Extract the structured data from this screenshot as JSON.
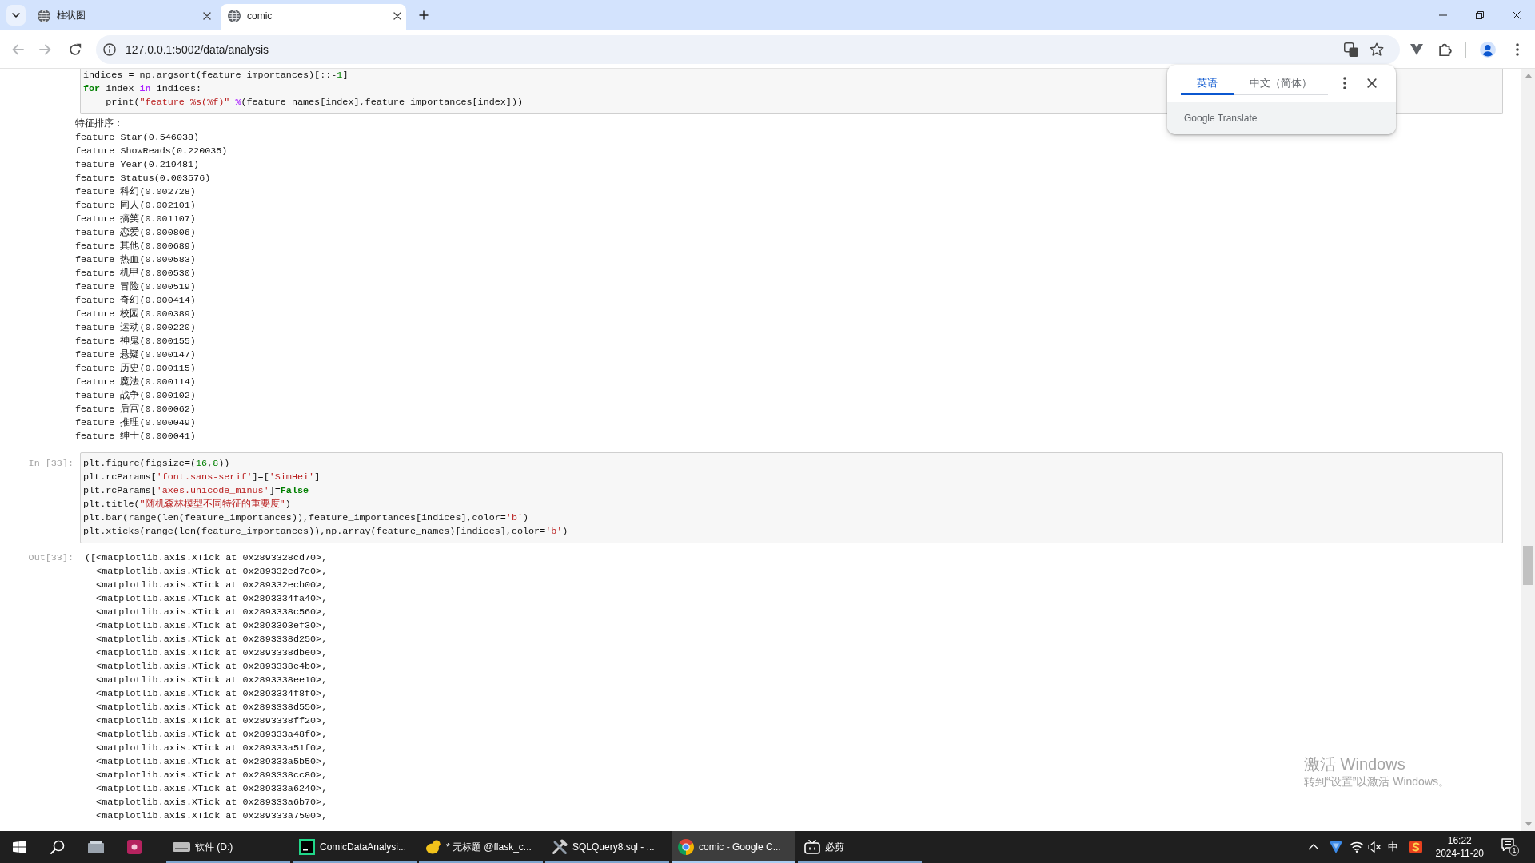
{
  "browser": {
    "tabs": [
      {
        "title": "柱状图",
        "selected": false
      },
      {
        "title": "comic",
        "selected": true
      }
    ],
    "back_disabled": true,
    "forward_disabled": true,
    "address": "127.0.0.1:5002/data/analysis"
  },
  "notebook": {
    "cells": [
      {
        "input": [
          [
            {
              "kind": "plain",
              "text": "indices = np.argsort(feature_importances)[::-"
            },
            {
              "kind": "number",
              "text": "1"
            },
            {
              "kind": "plain",
              "text": "]"
            }
          ],
          [
            {
              "kind": "keyword",
              "text": "for"
            },
            {
              "kind": "plain",
              "text": " index "
            },
            {
              "kind": "operator",
              "text": "in"
            },
            {
              "kind": "plain",
              "text": " indices:"
            }
          ],
          [
            {
              "kind": "plain",
              "text": "    print("
            },
            {
              "kind": "string",
              "text": "\"feature %s(%f)\""
            },
            {
              "kind": "operator",
              "text": " %"
            },
            {
              "kind": "plain",
              "text": "(feature_names[index],feature_importances[index]))"
            }
          ]
        ],
        "output": {
          "kind": "stream",
          "lines": [
            "特征排序：",
            "feature Star(0.546038)",
            "feature ShowReads(0.220035)",
            "feature Year(0.219481)",
            "feature Status(0.003576)",
            "feature 科幻(0.002728)",
            "feature 同人(0.002101)",
            "feature 搞笑(0.001107)",
            "feature 恋爱(0.000806)",
            "feature 其他(0.000689)",
            "feature 热血(0.000583)",
            "feature 机甲(0.000530)",
            "feature 冒险(0.000519)",
            "feature 奇幻(0.000414)",
            "feature 校园(0.000389)",
            "feature 运动(0.000220)",
            "feature 神鬼(0.000155)",
            "feature 悬疑(0.000147)",
            "feature 历史(0.000115)",
            "feature 魔法(0.000114)",
            "feature 战争(0.000102)",
            "feature 后宫(0.000062)",
            "feature 推理(0.000049)",
            "feature 绅士(0.000041)"
          ]
        }
      },
      {
        "prompt": "In [33]:",
        "input": [
          [
            {
              "kind": "plain",
              "text": "plt.figure(figsize=("
            },
            {
              "kind": "number",
              "text": "16"
            },
            {
              "kind": "plain",
              "text": ","
            },
            {
              "kind": "number",
              "text": "8"
            },
            {
              "kind": "plain",
              "text": "))"
            }
          ],
          [
            {
              "kind": "plain",
              "text": "plt.rcParams["
            },
            {
              "kind": "string",
              "text": "'font.sans-serif'"
            },
            {
              "kind": "plain",
              "text": "]=["
            },
            {
              "kind": "string",
              "text": "'SimHei'"
            },
            {
              "kind": "plain",
              "text": "]"
            }
          ],
          [
            {
              "kind": "plain",
              "text": "plt.rcParams["
            },
            {
              "kind": "string",
              "text": "'axes.unicode_minus'"
            },
            {
              "kind": "plain",
              "text": "]="
            },
            {
              "kind": "keyword",
              "text": "False"
            }
          ],
          [
            {
              "kind": "plain",
              "text": "plt.title("
            },
            {
              "kind": "string",
              "text": "\"随机森林模型不同特征的重要度\""
            },
            {
              "kind": "plain",
              "text": ")"
            }
          ],
          [
            {
              "kind": "plain",
              "text": "plt.bar(range(len(feature_importances)),feature_importances[indices],color="
            },
            {
              "kind": "string",
              "text": "'b'"
            },
            {
              "kind": "plain",
              "text": ")"
            }
          ],
          [
            {
              "kind": "plain",
              "text": "plt.xticks(range(len(feature_importances)),np.array(feature_names)[indices],color="
            },
            {
              "kind": "string",
              "text": "'b'"
            },
            {
              "kind": "plain",
              "text": ")"
            }
          ]
        ],
        "output": {
          "kind": "result",
          "prompt": "Out[33]:",
          "lines": [
            "([<matplotlib.axis.XTick at 0x2893328cd70>,",
            "  <matplotlib.axis.XTick at 0x289332ed7c0>,",
            "  <matplotlib.axis.XTick at 0x289332ecb00>,",
            "  <matplotlib.axis.XTick at 0x2893334fa40>,",
            "  <matplotlib.axis.XTick at 0x2893338c560>,",
            "  <matplotlib.axis.XTick at 0x2893303ef30>,",
            "  <matplotlib.axis.XTick at 0x2893338d250>,",
            "  <matplotlib.axis.XTick at 0x2893338dbe0>,",
            "  <matplotlib.axis.XTick at 0x2893338e4b0>,",
            "  <matplotlib.axis.XTick at 0x2893338ee10>,",
            "  <matplotlib.axis.XTick at 0x2893334f8f0>,",
            "  <matplotlib.axis.XTick at 0x2893338d550>,",
            "  <matplotlib.axis.XTick at 0x2893338ff20>,",
            "  <matplotlib.axis.XTick at 0x289333a48f0>,",
            "  <matplotlib.axis.XTick at 0x289333a51f0>,",
            "  <matplotlib.axis.XTick at 0x289333a5b50>,",
            "  <matplotlib.axis.XTick at 0x2893338cc80>,",
            "  <matplotlib.axis.XTick at 0x289333a6240>,",
            "  <matplotlib.axis.XTick at 0x289333a6b70>,",
            "  <matplotlib.axis.XTick at 0x289333a7500>,"
          ]
        }
      }
    ]
  },
  "translate_popup": {
    "tabs": [
      {
        "label": "英语",
        "selected": true
      },
      {
        "label": "中文（简体）",
        "selected": false
      }
    ],
    "footer": "Google Translate"
  },
  "activation_notice": {
    "title": "激活 Windows",
    "message": "转到“设置”以激活 Windows。"
  },
  "taskbar": {
    "items": [
      {
        "kind": "drive",
        "label": "软件 (D:)",
        "selected": false
      },
      {
        "kind": "ide",
        "label": "ComicDataAnalysi...",
        "selected": false
      },
      {
        "kind": "query",
        "label": "* 无标题 @flask_c...",
        "selected": false
      },
      {
        "kind": "sql",
        "label": "SQLQuery8.sql - ...",
        "selected": false
      },
      {
        "kind": "browser",
        "label": "comic - Google C...",
        "selected": true
      },
      {
        "kind": "video",
        "label": "必剪",
        "selected": false
      }
    ],
    "volume_muted": true,
    "input_method": "中",
    "time": "16:22",
    "date": "2024-11-20",
    "notification_count": "1"
  }
}
